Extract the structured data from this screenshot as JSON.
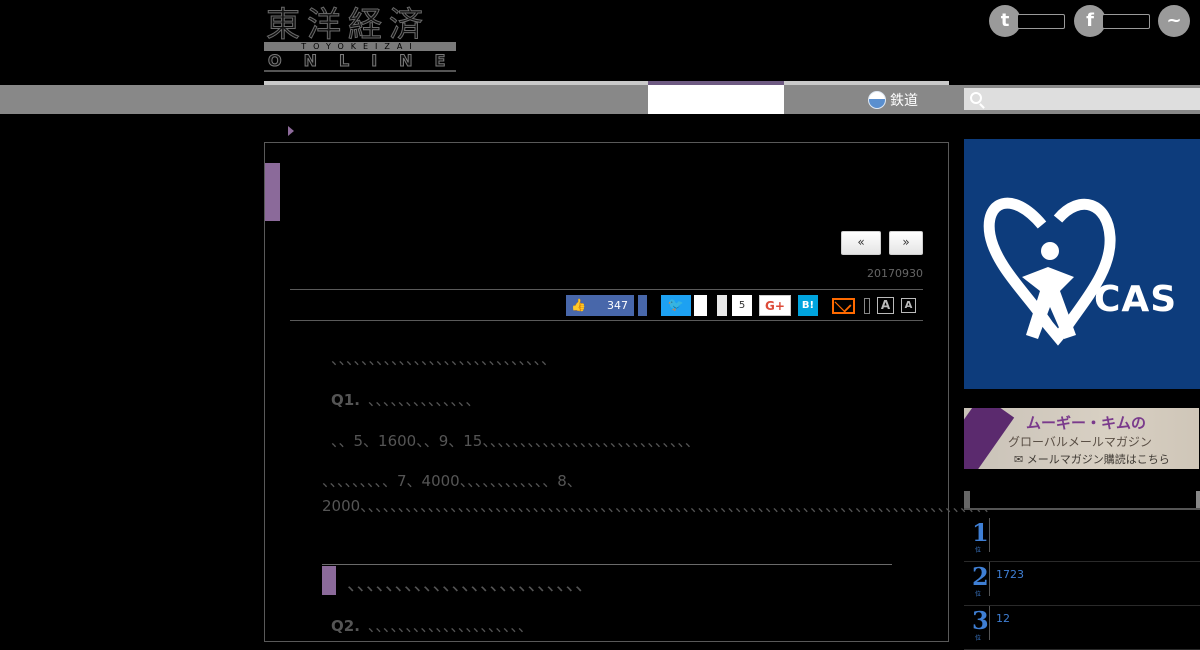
{
  "header": {
    "logo": {
      "kanji": "東洋経済",
      "roman": "TOYOKEIZAI",
      "online": "ONLINE"
    },
    "social": [
      {
        "name": "twitter",
        "glyph": "t"
      },
      {
        "name": "facebook",
        "glyph": "f"
      },
      {
        "name": "messenger",
        "glyph": "~"
      }
    ]
  },
  "nav": {
    "rail_label": "鉄道",
    "search": {
      "placeholder": ""
    }
  },
  "article": {
    "pager": {
      "prev": "«",
      "next": "»"
    },
    "date": "20170930",
    "share": {
      "fb_like_count": "347",
      "twitter_glyph": "🐦",
      "bubble_count": "5",
      "gplus": "G+",
      "hatena": "B!",
      "font_large": "A",
      "font_small": "A"
    },
    "intro": "、、、、、、、、、、、、、、、、、、、、、、、、、、、、、",
    "q1": {
      "label": "Q1.",
      "text": "、、、、、、、、、、、、、、"
    },
    "p2": "、、5、1600、、9、15、、、、、、、、、、、、、、、、、、、、、、、、、、、、",
    "p3": "、、、、、、、、、7、4000、、、、、、、、、、、、8、2000、、、、、、、、、、、、、、、、、、、、、、、、、、、、、、、、、、、、、、、、、、、、、、、、、、、、、、、、、、、、、、、、、、、、、、、、、、、、、、、、、、、、",
    "h2": "、、、、、、、、、、、、、、、、、、、、、、、、、",
    "q2": {
      "label": "Q2.",
      "text": "、、、、、、、、、、、、、、、、、、、、、"
    }
  },
  "sidebar": {
    "ad_big_text": "CAS",
    "ad_banner": {
      "line1": "ムーギー・キムの",
      "line2": "グローバルメールマガジン",
      "line3": "✉ メールマガジン購読はこちら"
    },
    "ranking": [
      {
        "rank": "1",
        "sub": "位",
        "text": ""
      },
      {
        "rank": "2",
        "sub": "位",
        "text": "1723"
      },
      {
        "rank": "3",
        "sub": "位",
        "text": "12"
      }
    ]
  },
  "colors": {
    "accent_purple": "#8b6a9a",
    "nav_gray": "#888888",
    "facebook": "#4867aa",
    "twitter": "#1da1f2",
    "hatena": "#00a4de",
    "ranking_blue": "#3f7fd4"
  }
}
